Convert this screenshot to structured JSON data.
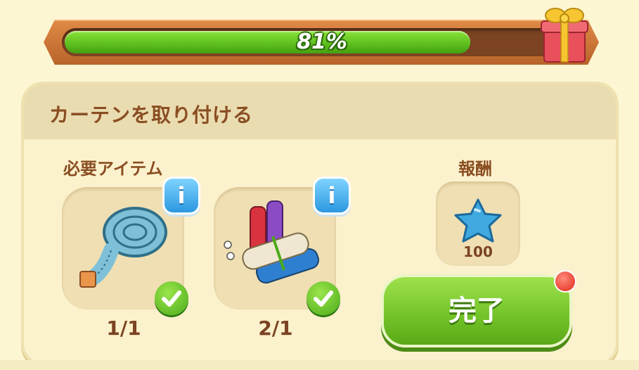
{
  "progress": {
    "value": 0.81,
    "label": "81%"
  },
  "task": {
    "title": "カーテンを取り付ける",
    "required_label": "必要アイテム",
    "reward_label": "報酬"
  },
  "items": [
    {
      "icon": "measuring-tape-icon",
      "count": "1/1",
      "info": "i"
    },
    {
      "icon": "fabric-rolls-icon",
      "count": "2/1",
      "info": "i"
    }
  ],
  "reward": {
    "icon": "blue-star-icon",
    "amount": "100"
  },
  "complete_button": {
    "label": "完了"
  }
}
